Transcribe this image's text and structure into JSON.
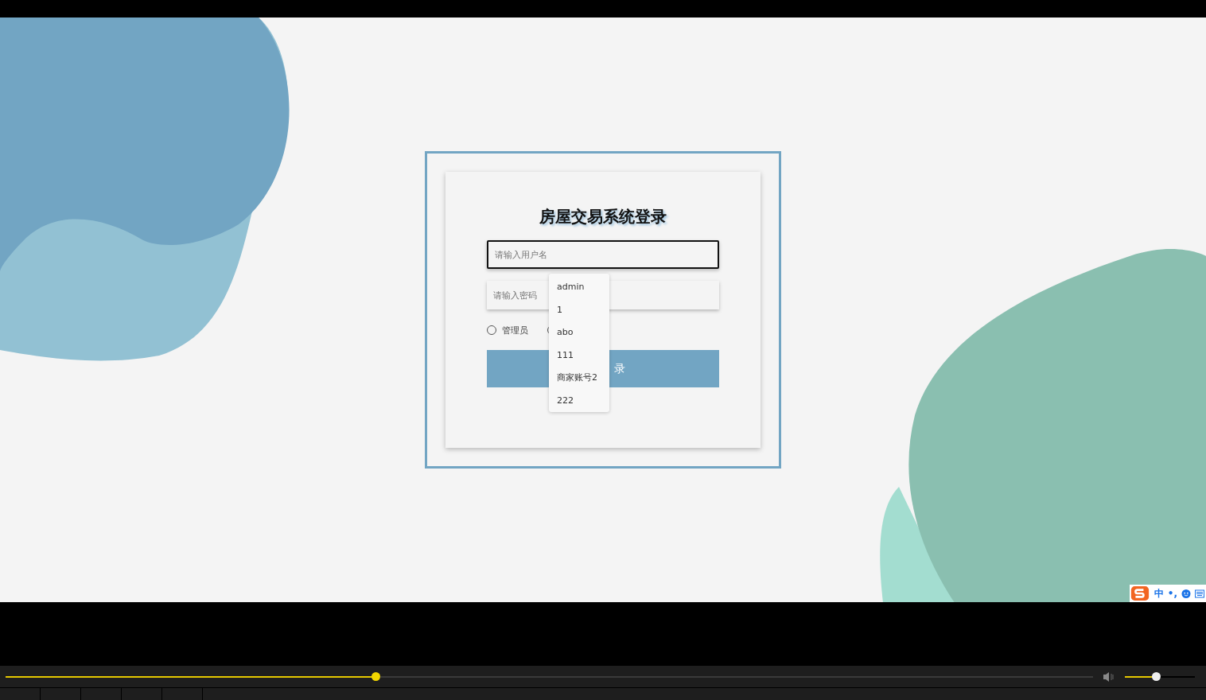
{
  "login": {
    "title": "房屋交易系统登录",
    "username": {
      "placeholder": "请输入用户名",
      "focused": true
    },
    "password": {
      "placeholder": "请输入密码"
    },
    "roles": [
      {
        "label": "管理员",
        "selected": false
      },
      {
        "selected": false
      }
    ],
    "submit": {
      "label": "录"
    },
    "suggestions": [
      "admin",
      "1",
      "abo",
      "111",
      "商家账号2",
      "222"
    ]
  },
  "ime": {
    "mode": "中",
    "punctuation": "•,"
  },
  "player": {
    "progress": {
      "level": 0.34
    },
    "volume": {
      "level": 0.44
    }
  }
}
